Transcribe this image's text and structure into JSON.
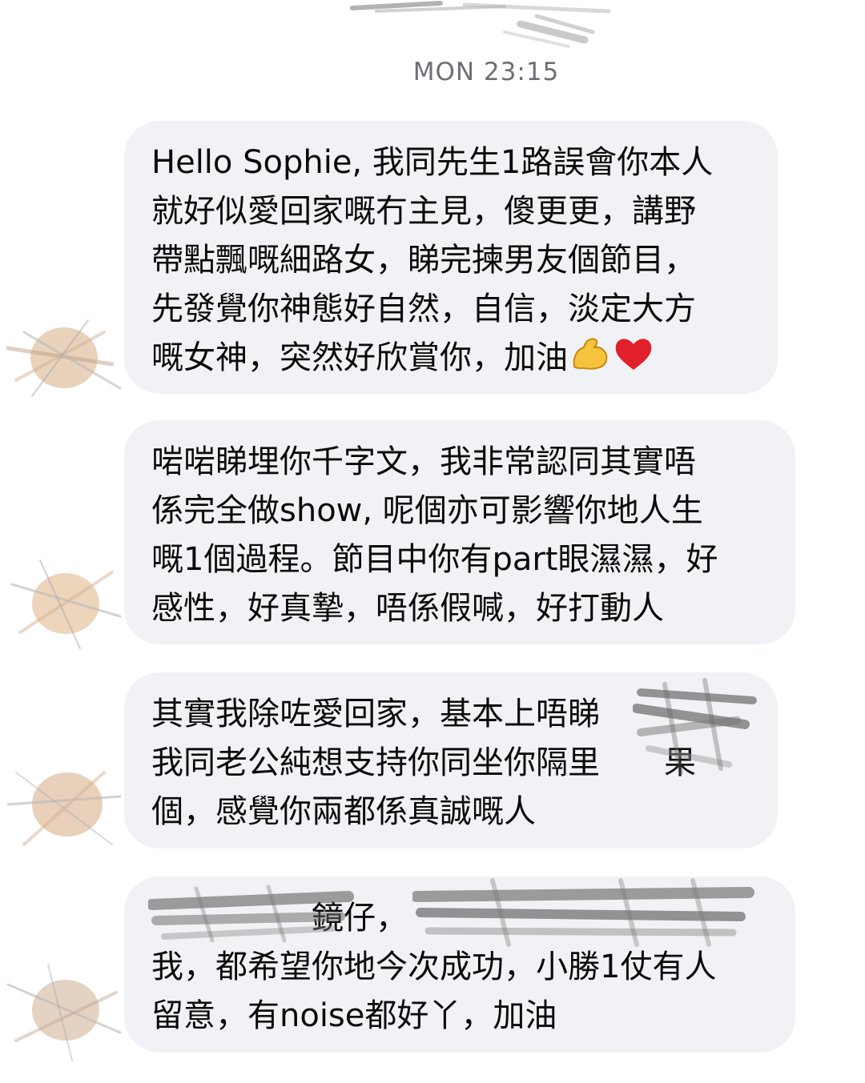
{
  "conversation": {
    "timestamp": "MON 23:15",
    "messages": [
      {
        "lines": [
          "Hello Sophie, 我同先生1路誤會你本人",
          "就好似愛回家嘅冇主見，傻更更，講野",
          "帶點飄嘅細路女，睇完揀男友個節目，",
          "先發覺你神態好自然，自信，淡定大方",
          "嘅女神，突然好欣賞你，加油"
        ],
        "emojis": [
          "flexed-biceps-icon",
          "red-heart-icon"
        ]
      },
      {
        "lines": [
          "啱啱睇埋你千字文，我非常認同其實唔",
          "係完全做show, 呢個亦可影響你地人生",
          "嘅1個過程。節目中你有part眼濕濕，好",
          "感性，好真摯，唔係假喊，好打動人"
        ]
      },
      {
        "lines": [
          "其實我除咗愛回家，基本上唔睇",
          "我同老公純想支持你同坐你隔里　　果",
          "個，感覺你兩都係真誠嘅人"
        ]
      },
      {
        "lines": [
          "　　　　　鏡仔，",
          "我，都希望你地今次成功，小勝1仗有人",
          "留意，有noise都好丫，加油"
        ]
      }
    ]
  },
  "colors": {
    "bubble_bg": "#f1f2f5",
    "timestamp": "#6b6f76",
    "text": "#0b0b0c"
  }
}
